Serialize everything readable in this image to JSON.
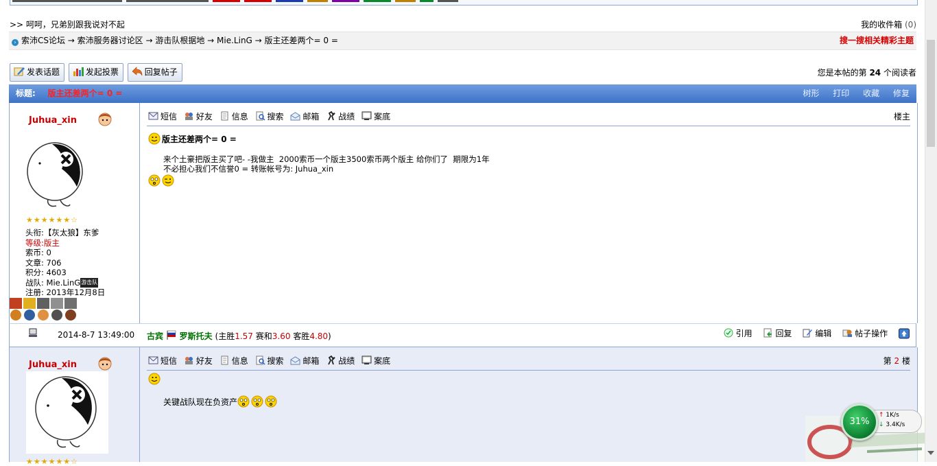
{
  "top": {
    "greeting": ">> 呵呵，兄弟别跟我说对不起",
    "inbox_label": "我的收件箱",
    "inbox_count": "(0)"
  },
  "breadcrumb": {
    "path": "索沛CS论坛 → 索沛服务器讨论区 → 游击队根据地 → Mie.LinG → 版主还差两个= 0 =",
    "search_link": "搜一搜相关精彩主题"
  },
  "toolbar": {
    "new_topic": "发表话题",
    "new_poll": "发起投票",
    "reply": "回复帖子",
    "readers_prefix": "您是本帖的第",
    "readers_count": "24",
    "readers_suffix": "个阅读者"
  },
  "titlebar": {
    "label": "标题:",
    "title": "版主还差两个= 0 =",
    "actions": [
      "树形",
      "打印",
      "收藏",
      "修复"
    ]
  },
  "post_tools": [
    "短信",
    "好友",
    "信息",
    "搜索",
    "邮箱",
    "战绩",
    "案底"
  ],
  "post1": {
    "username": "Juhua_xin",
    "stars": "★★★★★★☆",
    "stats": {
      "title_label": "头衔:",
      "title_value": "【灰太狼】东爹",
      "level_label": "等级:",
      "level_value": "版主",
      "coins_label": "索币:",
      "coins_value": "0",
      "posts_label": "文章:",
      "posts_value": "706",
      "points_label": "积分:",
      "points_value": "4603",
      "team_label": "战队:",
      "team_value": "Mie.LinG",
      "team_tag": "游击队",
      "reg_label": "注册:",
      "reg_value": "2013年12月8日"
    },
    "floor_label": "楼主",
    "post_title": "版主还差两个= 0 =",
    "body_line1": "来个土豪把版主买了吧- -我做主  2000索币一个版主3500索币两个版主 给你们了  期限为1年",
    "body_line2": "不必担心我们不信誉0 = 转账帐号为: Juhua_xin"
  },
  "info": {
    "date": "2014-8-7 13:49:00",
    "home": "古宾",
    "away": "罗斯托夫",
    "odds_open": "(主胜",
    "odds_home": "1.57",
    "odds_mid": "赛和",
    "odds_draw": "3.60",
    "odds_away_label": "客胜",
    "odds_away": "4.80",
    "odds_close": ")",
    "ops": [
      "引用",
      "回复",
      "编辑",
      "帖子操作"
    ]
  },
  "post2": {
    "username": "Juhua_xin",
    "floor_prefix": "第",
    "floor_num": "2",
    "floor_suffix": "楼",
    "body": "关键战队现在负资产"
  },
  "netmon": {
    "percent": "31%",
    "up": "1K/s",
    "down": "3.4K/s"
  },
  "colors": {
    "title_bar": "#3d72c6",
    "accent_red": "#c80000",
    "border_blue": "#8aa6d6"
  }
}
